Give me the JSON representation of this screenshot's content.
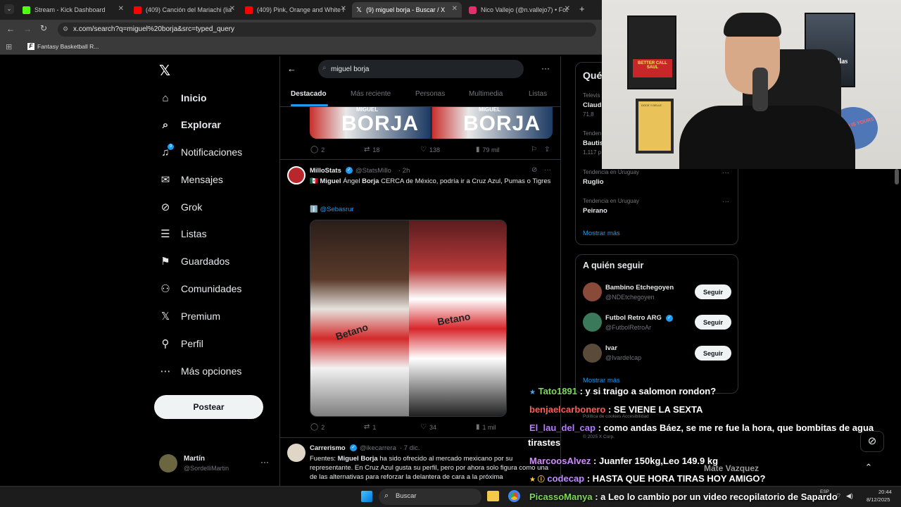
{
  "browser": {
    "tabs": [
      {
        "title": "Stream - Kick Dashboard",
        "color": "#53fc18"
      },
      {
        "title": "(409) Canción del Mariachi (lia",
        "color": "#ff0000"
      },
      {
        "title": "(409) Pink, Orange and White I",
        "color": "#ff0000"
      },
      {
        "title": "(9) miguel borja - Buscar / X",
        "color": "#ffffff"
      },
      {
        "title": "Nico Vallejo (@n.vallejo7) • Fot",
        "color": "#e1306c"
      }
    ],
    "new_tab": "+",
    "url": "x.com/search?q=miguel%20borja&src=typed_query",
    "bookmark": "Fantasy Basketball R..."
  },
  "nav": {
    "items": [
      {
        "label": "Inicio",
        "icon": "home-icon",
        "glyph": "⌂"
      },
      {
        "label": "Explorar",
        "icon": "search-icon",
        "glyph": "⌕"
      },
      {
        "label": "Notificaciones",
        "icon": "bell-icon",
        "glyph": "🔔"
      },
      {
        "label": "Mensajes",
        "icon": "mail-icon",
        "glyph": "✉"
      },
      {
        "label": "Grok",
        "icon": "grok-icon",
        "glyph": "⊘"
      },
      {
        "label": "Listas",
        "icon": "list-icon",
        "glyph": "☰"
      },
      {
        "label": "Guardados",
        "icon": "bookmark-icon",
        "glyph": "⚑"
      },
      {
        "label": "Comunidades",
        "icon": "communities-icon",
        "glyph": "⚇"
      },
      {
        "label": "Premium",
        "icon": "x-logo-icon",
        "glyph": "𝕏"
      },
      {
        "label": "Perfil",
        "icon": "person-icon",
        "glyph": "⚲"
      },
      {
        "label": "Más opciones",
        "icon": "more-circle-icon",
        "glyph": "⋯"
      }
    ],
    "post_button": "Postear",
    "account": {
      "name": "Martín",
      "handle": "@SordelliMartin"
    }
  },
  "search": {
    "query": "miguel borja",
    "tabs": [
      "Destacado",
      "Más reciente",
      "Personas",
      "Multimedia",
      "Listas"
    ]
  },
  "tweets": [
    {
      "image_text": [
        "BORJA",
        "BORJA"
      ],
      "image_sub": [
        "MIGUEL",
        "MIGUEL"
      ],
      "replies": "2",
      "retweets": "18",
      "likes": "138",
      "views": "79 mil"
    },
    {
      "name": "MilloStats",
      "handle": "@StatsMillo",
      "time": "· 2h",
      "text_prefix": "🇲🇽 ",
      "text_b1": "Miguel",
      "text_mid": " Ángel ",
      "text_b2": "Borja",
      "text_rest": " CERCA de México, podría ir a Cruz Azul, Pumas o Tigres",
      "source": "ℹ️ @Sebasrur",
      "replies": "2",
      "retweets": "1",
      "likes": "34",
      "views": "1 mil"
    },
    {
      "name": "Carrerismo",
      "handle": "@ikecarrera",
      "time": "· 7 dic.",
      "text_a": "Fuentes: ",
      "text_b": "Miguel Borja",
      "text_c": " ha sido ofrecido al mercado mexicano por su representante. En Cruz Azul gusta su perfil, pero por ahora solo figura como una de las alternativas para reforzar la delantera de cara a la próxima"
    }
  ],
  "trends": {
    "title": "Qué",
    "items": [
      {
        "context": "Televis",
        "name": "Claud",
        "count": "71,8"
      },
      {
        "context": "Tenden",
        "name": "Bautis",
        "count": "1.117 p"
      },
      {
        "context": "Tendencia en Uruguay",
        "name": "Ruglio",
        "count": ""
      },
      {
        "context": "Tendencia en Uruguay",
        "name": "Peirano",
        "count": ""
      }
    ],
    "show_more": "Mostrar más"
  },
  "follow": {
    "title": "A quién seguir",
    "items": [
      {
        "name": "Bambino Etchegoyen",
        "handle": "@NDEtchegoyen",
        "verified": false
      },
      {
        "name": "Futbol Retro ARG",
        "handle": "@FutbolRetroAr",
        "verified": true
      },
      {
        "name": "Ivar",
        "handle": "@IvardeIcap",
        "verified": false
      }
    ],
    "button": "Seguir",
    "show_more": "Mostrar más"
  },
  "footer": {
    "links": "Política de cookies   Accesibilidad",
    "copy": "© 2025 X Corp."
  },
  "chat": [
    {
      "user": "Tato1891",
      "color": "#7ed957",
      "msg": " : y si traigo a salomon rondon?",
      "badge": "★"
    },
    {
      "user": "benjaelcarbonero",
      "color": "#ff5a5a",
      "msg": " : SE VIENE LA SEXTA",
      "badge": ""
    },
    {
      "user": "El_lau_del_cap",
      "color": "#b57bff",
      "msg": " : como andas Báez, se me re fue la hora, que bombitas de agua",
      "badge": ""
    },
    {
      "user": "",
      "color": "#ffffff",
      "msg": "tirastes",
      "badge": ""
    },
    {
      "user": "MarcoosAlvez",
      "color": "#d08cff",
      "msg": " : Juanfer 150kg,Leo 149.9 kg",
      "badge": ""
    },
    {
      "user": "codecap",
      "color": "#c08cff",
      "msg": " : HASTA QUE HORA TIRAS HOY AMIGO?",
      "badge": "★ ⓘ"
    },
    {
      "user": "PicassoManya",
      "color": "#7ed957",
      "msg": " : a Leo lo cambio por un video recopilatorio de Sapardo",
      "badge": ""
    }
  ],
  "chat_extra": "Mate Vazquez",
  "taskbar": {
    "search": "Buscar",
    "lang": "ESP",
    "time": "20:44",
    "date": "8/12/2025"
  },
  "webcam": {
    "poster1_top": "BETTER CALL",
    "poster1_bottom": "SAUL",
    "poster2": "GoodFellas",
    "poster3": "DOCE Y DELLE",
    "sign": "WORLD IS YOURS"
  }
}
